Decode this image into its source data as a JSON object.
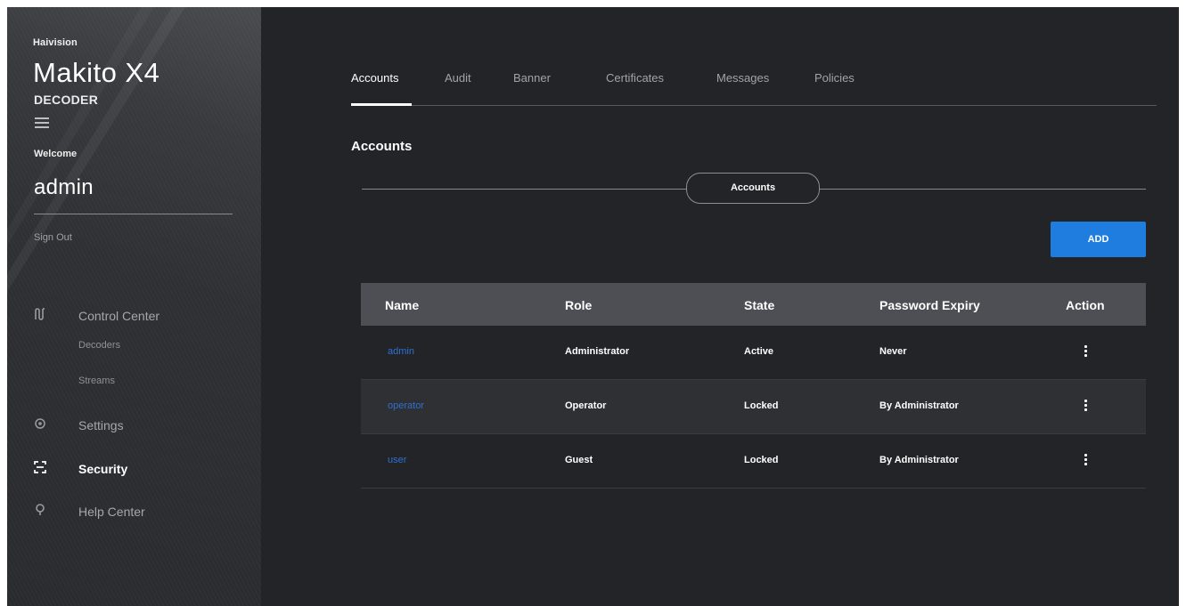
{
  "brand": {
    "company": "Haivision",
    "product": "Makito X4",
    "product_sub": "DECODER"
  },
  "sidebar": {
    "welcome": "Welcome",
    "username": "admin",
    "sign_out": "Sign Out",
    "nav": [
      {
        "label": "Control Center",
        "icon": "control-center-icon"
      },
      {
        "label": "Settings",
        "icon": "gear-icon"
      },
      {
        "label": "Security",
        "icon": "security-icon",
        "active": true
      },
      {
        "label": "Help Center",
        "icon": "help-icon"
      }
    ],
    "subnav": [
      "Decoders",
      "Streams"
    ]
  },
  "tabs": [
    "Accounts",
    "Audit",
    "Banner",
    "Certificates",
    "Messages",
    "Policies"
  ],
  "active_tab": "Accounts",
  "section_title": "Accounts",
  "pill_label": "Accounts",
  "add_button": "ADD",
  "table": {
    "headers": [
      "Name",
      "Role",
      "State",
      "Password Expiry",
      "Action"
    ],
    "rows": [
      {
        "name": "admin",
        "role": "Administrator",
        "state": "Active",
        "expiry": "Never"
      },
      {
        "name": "operator",
        "role": "Operator",
        "state": "Locked",
        "expiry": "By Administrator"
      },
      {
        "name": "user",
        "role": "Guest",
        "state": "Locked",
        "expiry": "By Administrator"
      }
    ]
  },
  "colors": {
    "accent": "#1f7ddf",
    "link": "#2f6fd0",
    "background": "#232428",
    "header_row": "#4d4f55"
  }
}
